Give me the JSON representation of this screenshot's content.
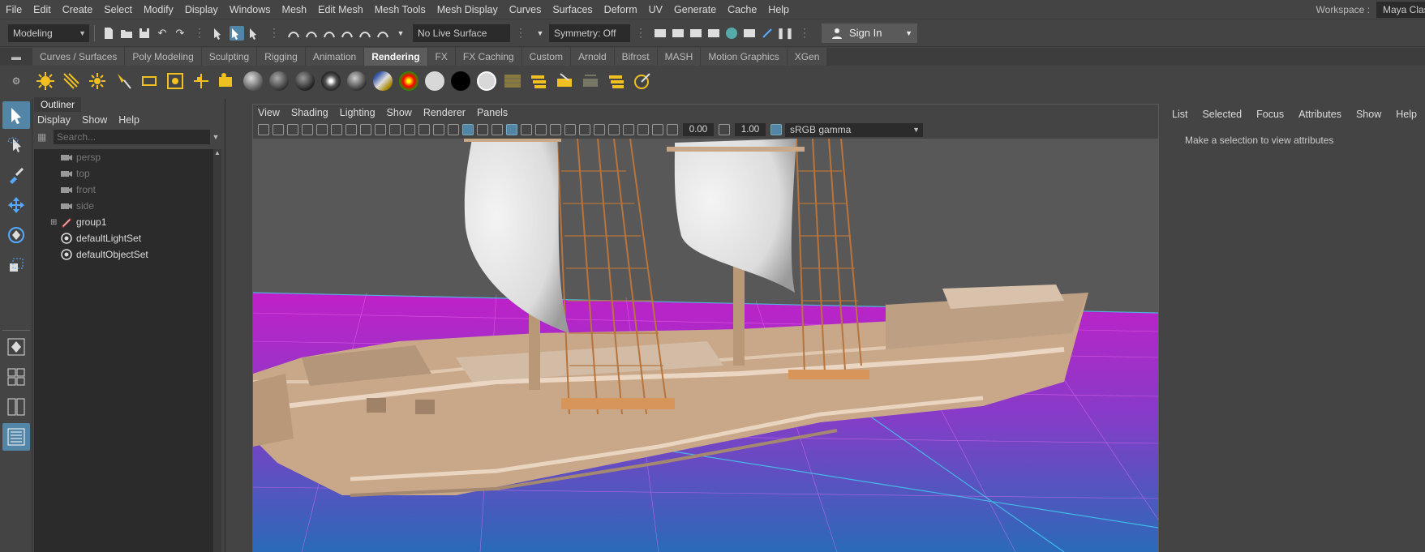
{
  "menubar": {
    "items": [
      "File",
      "Edit",
      "Create",
      "Select",
      "Modify",
      "Display",
      "Windows",
      "Mesh",
      "Edit Mesh",
      "Mesh Tools",
      "Mesh Display",
      "Curves",
      "Surfaces",
      "Deform",
      "UV",
      "Generate",
      "Cache",
      "Help"
    ],
    "workspace_label": "Workspace :",
    "workspace_value": "Maya Classic"
  },
  "statusline": {
    "mode": "Modeling",
    "live_surface": "No Live Surface",
    "symmetry": "Symmetry: Off",
    "sign_in": "Sign In"
  },
  "shelf": {
    "tabs": [
      "Curves / Surfaces",
      "Poly Modeling",
      "Sculpting",
      "Rigging",
      "Animation",
      "Rendering",
      "FX",
      "FX Caching",
      "Custom",
      "Arnold",
      "Bifrost",
      "MASH",
      "Motion Graphics",
      "XGen"
    ],
    "active_tab": "Rendering"
  },
  "outliner": {
    "title": "Outliner",
    "menu": [
      "Display",
      "Show",
      "Help"
    ],
    "search_placeholder": "Search...",
    "nodes": [
      {
        "label": "persp",
        "icon": "camera-icon",
        "dim": true
      },
      {
        "label": "top",
        "icon": "camera-icon",
        "dim": true
      },
      {
        "label": "front",
        "icon": "camera-icon",
        "dim": true
      },
      {
        "label": "side",
        "icon": "camera-icon",
        "dim": true
      },
      {
        "label": "group1",
        "icon": "group-icon",
        "dim": false,
        "expandable": true
      },
      {
        "label": "defaultLightSet",
        "icon": "set-icon",
        "dim": false
      },
      {
        "label": "defaultObjectSet",
        "icon": "set-icon",
        "dim": false
      }
    ]
  },
  "viewport": {
    "menu": [
      "View",
      "Shading",
      "Lighting",
      "Show",
      "Renderer",
      "Panels"
    ],
    "exposure": "0.00",
    "gamma": "1.00",
    "color_space": "sRGB gamma"
  },
  "attribute_editor": {
    "menu": [
      "List",
      "Selected",
      "Focus",
      "Attributes",
      "Show",
      "Help"
    ],
    "message": "Make a selection to view attributes"
  },
  "colors": {
    "accent": "#5285a6",
    "ground": "#c020c8",
    "sail": "#e8e8e8",
    "hull": "#c9a88a"
  }
}
